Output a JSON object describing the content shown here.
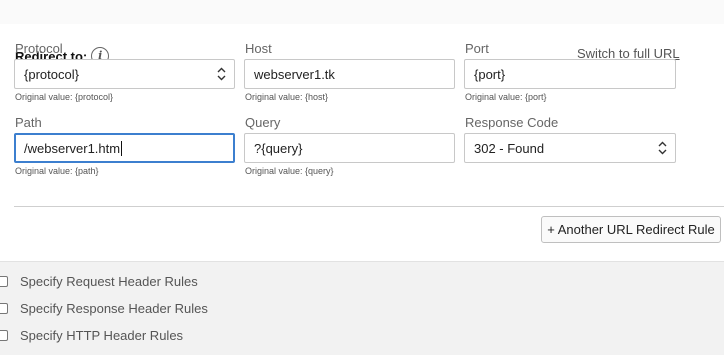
{
  "redirect": {
    "title": "Redirect to:",
    "info_icon": "info-icon",
    "switch_link": "Switch to full URL"
  },
  "fields": {
    "protocol": {
      "label": "Protocol",
      "value": "{protocol}",
      "original": "Original value: {protocol}"
    },
    "host": {
      "label": "Host",
      "value": "webserver1.tk",
      "original": "Original value: {host}"
    },
    "port": {
      "label": "Port",
      "value": "{port}",
      "original": "Original value: {port}"
    },
    "path": {
      "label": "Path",
      "value": "/webserver1.htm",
      "original": "Original value: {path}"
    },
    "query": {
      "label": "Query",
      "value": "?{query}",
      "original": "Original value: {query}"
    },
    "response_code": {
      "label": "Response Code",
      "value": "302 - Found"
    }
  },
  "add_rule_button": "+ Another URL Redirect Rule",
  "checkboxes": [
    {
      "label": "Specify Request Header Rules",
      "checked": false
    },
    {
      "label": "Specify Response Header Rules",
      "checked": false
    },
    {
      "label": "Specify HTTP Header Rules",
      "checked": false
    }
  ],
  "colors": {
    "focus_border": "#3c7fcf",
    "bottom_background": "#f2f2f2"
  }
}
